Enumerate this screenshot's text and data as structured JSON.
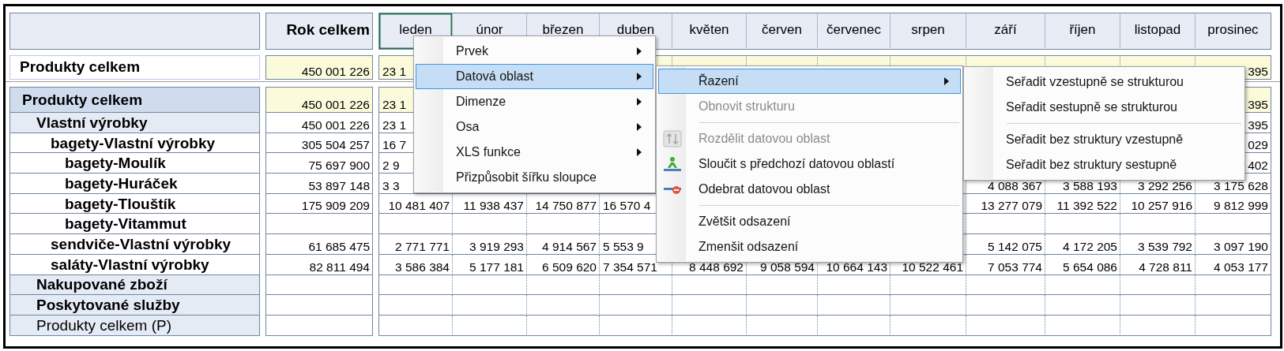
{
  "columns": {
    "total": "Rok celkem",
    "months": [
      {
        "label": "leden",
        "selected": true
      },
      {
        "label": "únor",
        "selected": false
      },
      {
        "label": "březen",
        "selected": false
      },
      {
        "label": "duben",
        "selected": false
      },
      {
        "label": "květen",
        "selected": false
      },
      {
        "label": "červen",
        "selected": false
      },
      {
        "label": "červenec",
        "selected": false
      },
      {
        "label": "srpen",
        "selected": false
      },
      {
        "label": "září",
        "selected": false
      },
      {
        "label": "říjen",
        "selected": false
      },
      {
        "label": "listopad",
        "selected": false
      },
      {
        "label": "prosinec",
        "selected": false
      }
    ]
  },
  "summary_row": {
    "label": "Produkty celkem",
    "bold": true,
    "values": {
      "total": "450 001 226",
      "m1": "23 1",
      "m12": "395"
    }
  },
  "table": {
    "rows": [
      {
        "label": "Produkty celkem",
        "bold": true,
        "values": {
          "total": "450 001 226",
          "m1": "23 1",
          "m12": "395"
        },
        "children": [
          {
            "label": "Vlastní výrobky",
            "bold": true,
            "values": {
              "total": "450 001 226",
              "m1": "23 1",
              "m12": "395"
            },
            "children": [
              {
                "label": "bagety-Vlastní výrobky",
                "bold": true,
                "values": {
                  "total": "305 504 257",
                  "m1": "16 7",
                  "m12": "029"
                },
                "children": [
                  {
                    "label": "bagety-Moulík",
                    "bold": true,
                    "values": {
                      "total": "75 697 900",
                      "m1": "2 9",
                      "m12": "402"
                    }
                  },
                  {
                    "label": "bagety-Huráček",
                    "bold": true,
                    "values": {
                      "total": "53 897 148",
                      "m1": "3 3",
                      "m9": "4 088 367",
                      "m10": "3 588 193",
                      "m11": "3 292 256",
                      "m12": "3 175 628"
                    }
                  },
                  {
                    "label": "bagety-Tlouštík",
                    "bold": true,
                    "values": {
                      "total": "175 909 209",
                      "m1": "10 481 407",
                      "m2": "11 938 437",
                      "m3": "14 750 877",
                      "m4": "16 570 4",
                      "m9": "13 277 079",
                      "m10": "11 392 522",
                      "m11": "10 257 916",
                      "m12": "9 812 999"
                    }
                  },
                  {
                    "label": "bagety-Vitammut",
                    "bold": true
                  }
                ]
              },
              {
                "label": "sendviče-Vlastní výrobky",
                "bold": true,
                "values": {
                  "total": "61 685 475",
                  "m1": "2 771 771",
                  "m2": "3 919 293",
                  "m3": "4 914 567",
                  "m4": "5 553 9",
                  "m9": "5 142 075",
                  "m10": "4 172 205",
                  "m11": "3 539 792",
                  "m12": "3 097 190"
                }
              },
              {
                "label": "saláty-Vlastní výrobky",
                "bold": true,
                "values": {
                  "total": "82 811 494",
                  "m1": "3 586 384",
                  "m2": "5 177 181",
                  "m3": "6 509 620",
                  "m4": "7 354 571",
                  "m5": "8 448 692",
                  "m6": "9 058 594",
                  "m7": "10 664 143",
                  "m8": "10 522 461",
                  "m9": "7 053 774",
                  "m10": "5 654 086",
                  "m11": "4 728 811",
                  "m12": "4 053 177"
                }
              }
            ]
          },
          {
            "label": "Nakupované zboží",
            "bold": true
          },
          {
            "label": "Poskytované služby",
            "bold": true
          },
          {
            "label": "Produkty celkem (P)",
            "bold": false
          }
        ]
      }
    ]
  },
  "context_menus": [
    {
      "items": [
        {
          "kind": "submenu",
          "label": "Prvek",
          "selected": false,
          "disabled": false
        },
        {
          "kind": "submenu",
          "label": "Datová oblast",
          "selected": true,
          "disabled": false
        },
        {
          "kind": "submenu",
          "label": "Dimenze",
          "selected": false,
          "disabled": false
        },
        {
          "kind": "submenu",
          "label": "Osa",
          "selected": false,
          "disabled": false
        },
        {
          "kind": "submenu",
          "label": "XLS funkce",
          "selected": false,
          "disabled": false
        },
        {
          "kind": "command",
          "label": "Přizpůsobit šířku sloupce",
          "selected": false,
          "disabled": false
        }
      ]
    },
    {
      "items": [
        {
          "kind": "submenu",
          "label": "Řazení",
          "selected": true,
          "disabled": false
        },
        {
          "kind": "command",
          "label": "Obnovit strukturu",
          "selected": false,
          "disabled": true
        },
        {
          "kind": "separator"
        },
        {
          "kind": "split",
          "label": "Rozdělit datovou oblast",
          "selected": false,
          "disabled": true
        },
        {
          "kind": "merge",
          "label": "Sloučit s předchozí datovou oblastí",
          "selected": false,
          "disabled": false
        },
        {
          "kind": "remove",
          "label": "Odebrat datovou oblast",
          "selected": false,
          "disabled": false
        },
        {
          "kind": "separator"
        },
        {
          "kind": "command",
          "label": "Zvětšit odsazení",
          "selected": false,
          "disabled": false
        },
        {
          "kind": "command",
          "label": "Zmenšit odsazení",
          "selected": false,
          "disabled": false
        }
      ]
    },
    {
      "items": [
        {
          "kind": "command",
          "label": "Seřadit vzestupně se strukturou",
          "selected": false,
          "disabled": false
        },
        {
          "kind": "command",
          "label": "Seřadit sestupně se strukturou",
          "selected": false,
          "disabled": false
        },
        {
          "kind": "separator"
        },
        {
          "kind": "command",
          "label": "Seřadit bez struktury vzestupně",
          "selected": false,
          "disabled": false
        },
        {
          "kind": "command",
          "label": "Seřadit bez struktury sestupně",
          "selected": false,
          "disabled": false
        }
      ]
    }
  ]
}
